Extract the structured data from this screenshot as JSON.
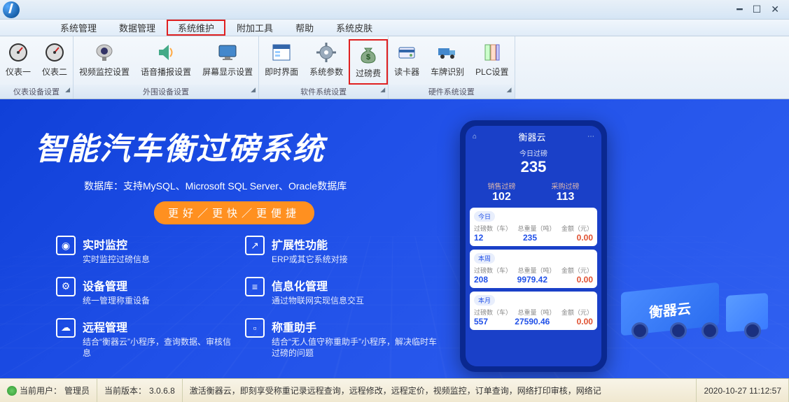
{
  "menu": {
    "items": [
      "系统管理",
      "数据管理",
      "系统维护",
      "附加工具",
      "帮助",
      "系统皮肤"
    ],
    "highlighted_index": 2
  },
  "ribbon": {
    "groups": [
      {
        "label": "仪表设备设置",
        "buttons": [
          {
            "label": "仪表一",
            "icon": "gauge-icon"
          },
          {
            "label": "仪表二",
            "icon": "gauge-icon"
          }
        ]
      },
      {
        "label": "外围设备设置",
        "buttons": [
          {
            "label": "视频监控设置",
            "icon": "camera-icon"
          },
          {
            "label": "语音播报设置",
            "icon": "speaker-icon"
          },
          {
            "label": "屏幕显示设置",
            "icon": "monitor-icon"
          }
        ]
      },
      {
        "label": "软件系统设置",
        "buttons": [
          {
            "label": "即时界面",
            "icon": "window-icon"
          },
          {
            "label": "系统参数",
            "icon": "gear-icon"
          },
          {
            "label": "过磅费",
            "icon": "moneybag-icon",
            "highlighted": true
          }
        ]
      },
      {
        "label": "硬件系统设置",
        "buttons": [
          {
            "label": "读卡器",
            "icon": "cardreader-icon"
          },
          {
            "label": "车牌识别",
            "icon": "truck-icon"
          },
          {
            "label": "PLC设置",
            "icon": "plc-icon"
          }
        ]
      }
    ]
  },
  "hero": {
    "headline": "智能汽车衡过磅系统",
    "subhead": "数据库：支持MySQL、Microsoft SQL Server、Oracle数据库",
    "badge": "更好／更快／更便捷",
    "features": [
      {
        "icon": "◉",
        "title": "实时监控",
        "desc": "实时监控过磅信息"
      },
      {
        "icon": "↗",
        "title": "扩展性功能",
        "desc": "ERP或其它系统对接"
      },
      {
        "icon": "⚙",
        "title": "设备管理",
        "desc": "统一管理称重设备"
      },
      {
        "icon": "≡",
        "title": "信息化管理",
        "desc": "通过物联网实现信息交互"
      },
      {
        "icon": "☁",
        "title": "远程管理",
        "desc": "结合“衡器云”小程序，查询数据、审核信息"
      },
      {
        "icon": "▫",
        "title": "称重助手",
        "desc": "结合“无人值守称重助手”小程序，解决临时车过磅的问题"
      }
    ]
  },
  "phone": {
    "app_title": "衡器云",
    "today": {
      "label": "今日过磅",
      "value": "235"
    },
    "split": [
      {
        "label": "销售过磅",
        "value": "102"
      },
      {
        "label": "采购过磅",
        "value": "113"
      }
    ],
    "cards": [
      {
        "tag": "今日",
        "cols": [
          "过磅数（车）",
          "总重量（吨）",
          "金额（元）"
        ],
        "vals": [
          "12",
          "235",
          "0.00"
        ]
      },
      {
        "tag": "本周",
        "cols": [
          "过磅数（车）",
          "总重量（吨）",
          "金额（元）"
        ],
        "vals": [
          "208",
          "9979.42",
          "0.00"
        ]
      },
      {
        "tag": "本月",
        "cols": [
          "过磅数（车）",
          "总重量（吨）",
          "金额（元）"
        ],
        "vals": [
          "557",
          "27590.46",
          "0.00"
        ]
      }
    ]
  },
  "truck_label": "衡器云",
  "statusbar": {
    "user_label": "当前用户：",
    "user_value": "管理员",
    "version_label": "当前版本：",
    "version_value": "3.0.6.8",
    "marquee": "激活衡器云，即刻享受称重记录远程查询，远程修改，远程定价，视频监控，订单查询，网络打印审核，网络记",
    "datetime": "2020-10-27 11:12:57"
  }
}
